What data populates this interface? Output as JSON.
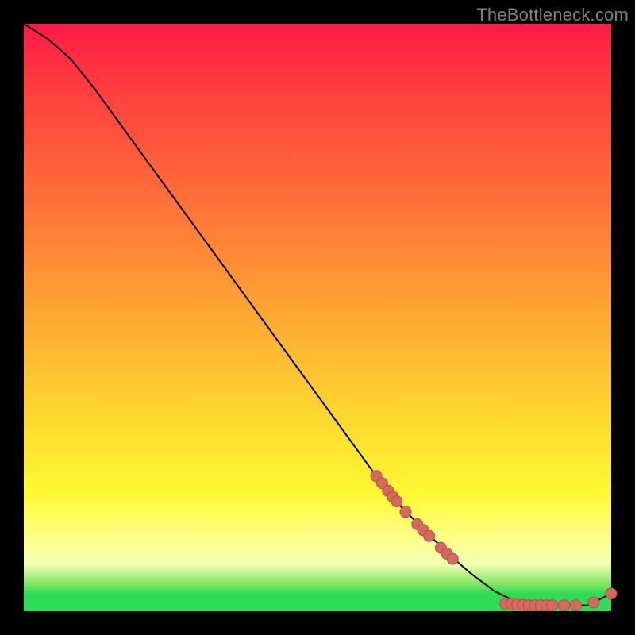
{
  "watermark": "TheBottleneck.com",
  "colors": {
    "page_bg": "#000000",
    "line": "#000000",
    "marker_fill": "#d46a5f",
    "marker_stroke": "#b94f45",
    "gradient_top": "#ff1a48",
    "gradient_bottom": "#2fdc57"
  },
  "chart_data": {
    "type": "line",
    "title": "",
    "xlabel": "",
    "ylabel": "",
    "xlim": [
      0,
      100
    ],
    "ylim": [
      0,
      100
    ],
    "grid": false,
    "series": [
      {
        "name": "curve",
        "x": [
          0,
          4,
          8,
          12,
          16,
          20,
          24,
          28,
          32,
          36,
          40,
          44,
          48,
          52,
          56,
          60,
          64,
          68,
          72,
          76,
          80,
          84,
          88,
          92,
          96,
          100
        ],
        "y": [
          100,
          97.5,
          94,
          89,
          83.5,
          78,
          72.5,
          67,
          61.5,
          56,
          50.5,
          45,
          39.5,
          34,
          28.5,
          23,
          18,
          14,
          10,
          6.5,
          3.5,
          1.5,
          1,
          1,
          1,
          3
        ]
      }
    ],
    "markers": [
      {
        "x": 60,
        "y": 23
      },
      {
        "x": 61,
        "y": 21.8
      },
      {
        "x": 62,
        "y": 20.5
      },
      {
        "x": 62.8,
        "y": 19.5
      },
      {
        "x": 63.5,
        "y": 18.7
      },
      {
        "x": 65,
        "y": 16.9
      },
      {
        "x": 67,
        "y": 14.8
      },
      {
        "x": 68,
        "y": 13.8
      },
      {
        "x": 69,
        "y": 12.8
      },
      {
        "x": 71,
        "y": 10.8
      },
      {
        "x": 72,
        "y": 9.8
      },
      {
        "x": 73,
        "y": 8.9
      },
      {
        "x": 82,
        "y": 1.3
      },
      {
        "x": 83,
        "y": 1.2
      },
      {
        "x": 84,
        "y": 1.1
      },
      {
        "x": 85,
        "y": 1.05
      },
      {
        "x": 86,
        "y": 1.0
      },
      {
        "x": 87,
        "y": 1.0
      },
      {
        "x": 88,
        "y": 1.0
      },
      {
        "x": 89,
        "y": 1.0
      },
      {
        "x": 90,
        "y": 1.0
      },
      {
        "x": 92,
        "y": 1.0
      },
      {
        "x": 94,
        "y": 1.0
      },
      {
        "x": 97,
        "y": 1.5
      },
      {
        "x": 100,
        "y": 3.0
      }
    ]
  }
}
